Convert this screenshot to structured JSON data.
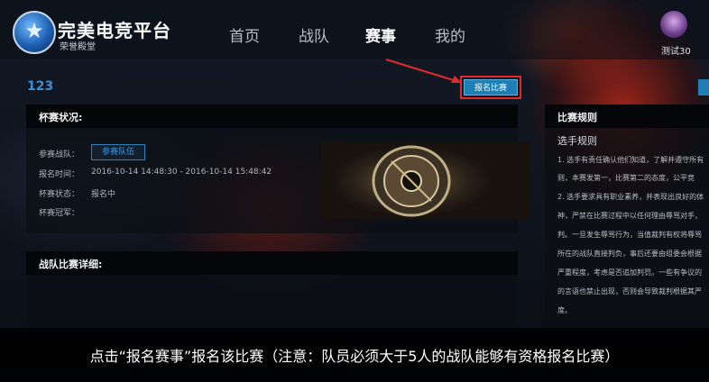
{
  "header": {
    "title": "完美电竞平台",
    "subtitle": "荣誉殿堂",
    "nav": [
      "首页",
      "战队",
      "赛事",
      "我的"
    ],
    "active_nav": "赛事",
    "user_name": "测试30"
  },
  "match": {
    "id": "123",
    "signup_label": "报名比赛"
  },
  "cup_status": {
    "title": "杯赛状况:",
    "participants_label": "参赛战队：",
    "participants_button": "参赛队伍",
    "signup_time_label": "报名时间：",
    "signup_time_value": "2016-10-14 14:48:30 - 2016-10-14 15:48:42",
    "status_label": "杯赛状态：",
    "status_value": "报名中",
    "champion_label": "杯赛冠军："
  },
  "team_details": {
    "title": "战队比赛详细:"
  },
  "rules": {
    "title": "比赛规则",
    "subtitle": "选手规则",
    "lines": [
      "1. 选手有责任确认他们知道，了解并遵守所有",
      "则，本赛发第一，比赛第二的态度，公平竞",
      "2. 选手要求具有职业素养，并表现出良好的体",
      "神，严禁在比赛过程中以任何理由辱骂对手，",
      "判。一旦发生辱骂行为，当值裁判有权将辱骂",
      "所在的战队直接判负，事后还要由组委会根据",
      "严重程度，考虑是否追加判罚。一些有争议的",
      "的言语也禁止出现，否则会导致裁判根据其严",
      "度。"
    ]
  },
  "caption": "点击“报名赛事”报名该比赛（注意：队员必须大于5人的战队能够有资格报名比赛）"
}
